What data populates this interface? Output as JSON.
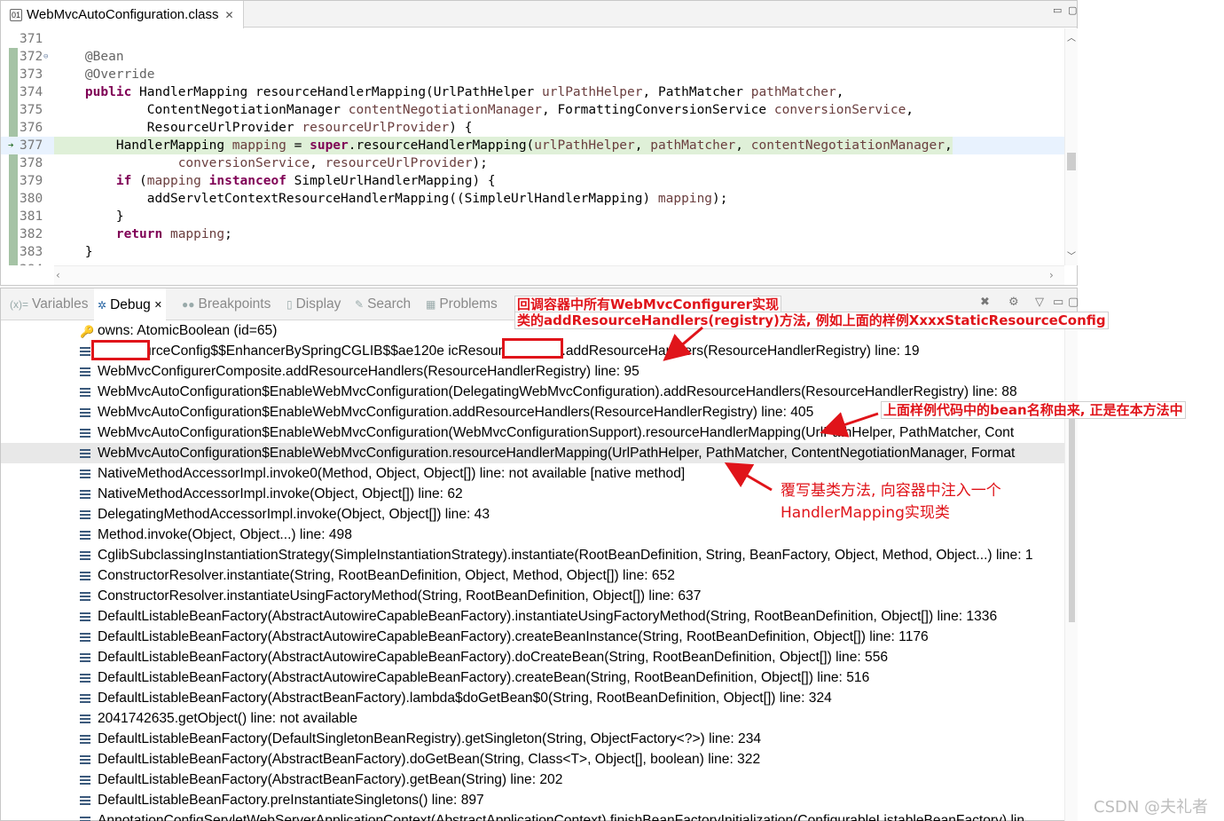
{
  "editor": {
    "tab_title": "WebMvcAutoConfiguration.class",
    "tab_icon": "class-file-icon",
    "lines": [
      {
        "num": "371",
        "tokens": [
          {
            "t": "",
            "c": ""
          }
        ]
      },
      {
        "num": "372",
        "tokens": [
          {
            "t": "    @Bean",
            "c": "ann"
          }
        ]
      },
      {
        "num": "373",
        "tokens": [
          {
            "t": "    @Override",
            "c": "ann"
          }
        ]
      },
      {
        "num": "374",
        "tokens": [
          {
            "t": "    ",
            "c": ""
          },
          {
            "t": "public",
            "c": "kw"
          },
          {
            "t": " HandlerMapping resourceHandlerMapping(UrlPathHelper ",
            "c": ""
          },
          {
            "t": "urlPathHelper",
            "c": "pr"
          },
          {
            "t": ", PathMatcher ",
            "c": ""
          },
          {
            "t": "pathMatcher",
            "c": "pr"
          },
          {
            "t": ",",
            "c": ""
          }
        ]
      },
      {
        "num": "375",
        "tokens": [
          {
            "t": "            ContentNegotiationManager ",
            "c": ""
          },
          {
            "t": "contentNegotiationManager",
            "c": "pr"
          },
          {
            "t": ", FormattingConversionService ",
            "c": ""
          },
          {
            "t": "conversionService",
            "c": "pr"
          },
          {
            "t": ",",
            "c": ""
          }
        ]
      },
      {
        "num": "376",
        "tokens": [
          {
            "t": "            ResourceUrlProvider ",
            "c": ""
          },
          {
            "t": "resourceUrlProvider",
            "c": "pr"
          },
          {
            "t": ") {",
            "c": ""
          }
        ]
      },
      {
        "num": "377",
        "tokens": [
          {
            "t": "        HandlerMapping ",
            "c": ""
          },
          {
            "t": "mapping",
            "c": "pr"
          },
          {
            "t": " = ",
            "c": ""
          },
          {
            "t": "super",
            "c": "kw"
          },
          {
            "t": ".resourceHandlerMapping(",
            "c": ""
          },
          {
            "t": "urlPathHelper",
            "c": "pr"
          },
          {
            "t": ", ",
            "c": ""
          },
          {
            "t": "pathMatcher",
            "c": "pr"
          },
          {
            "t": ", ",
            "c": ""
          },
          {
            "t": "contentNegotiationManager",
            "c": "pr"
          },
          {
            "t": ",",
            "c": ""
          }
        ]
      },
      {
        "num": "378",
        "tokens": [
          {
            "t": "                ",
            "c": ""
          },
          {
            "t": "conversionService",
            "c": "pr"
          },
          {
            "t": ", ",
            "c": ""
          },
          {
            "t": "resourceUrlProvider",
            "c": "pr"
          },
          {
            "t": ");",
            "c": ""
          }
        ]
      },
      {
        "num": "379",
        "tokens": [
          {
            "t": "        ",
            "c": ""
          },
          {
            "t": "if",
            "c": "kw"
          },
          {
            "t": " (",
            "c": ""
          },
          {
            "t": "mapping",
            "c": "pr"
          },
          {
            "t": " ",
            "c": ""
          },
          {
            "t": "instanceof",
            "c": "kw"
          },
          {
            "t": " SimpleUrlHandlerMapping) {",
            "c": ""
          }
        ]
      },
      {
        "num": "380",
        "tokens": [
          {
            "t": "            addServletContextResourceHandlerMapping((SimpleUrlHandlerMapping) ",
            "c": ""
          },
          {
            "t": "mapping",
            "c": "pr"
          },
          {
            "t": ");",
            "c": ""
          }
        ]
      },
      {
        "num": "381",
        "tokens": [
          {
            "t": "        }",
            "c": ""
          }
        ]
      },
      {
        "num": "382",
        "tokens": [
          {
            "t": "        ",
            "c": ""
          },
          {
            "t": "return",
            "c": "kw"
          },
          {
            "t": " ",
            "c": ""
          },
          {
            "t": "mapping",
            "c": "pr"
          },
          {
            "t": ";",
            "c": ""
          }
        ]
      },
      {
        "num": "383",
        "tokens": [
          {
            "t": "    }",
            "c": ""
          }
        ]
      },
      {
        "num": "384",
        "tokens": [
          {
            "t": "",
            "c": ""
          }
        ]
      }
    ],
    "highlighted_line": "377"
  },
  "debug": {
    "tabs": [
      {
        "label": "Variables",
        "icon": "variables-icon",
        "active": false
      },
      {
        "label": "Debug",
        "icon": "debug-bug-icon",
        "active": true
      },
      {
        "label": "Breakpoints",
        "icon": "breakpoints-icon",
        "active": false
      },
      {
        "label": "Display",
        "icon": "display-icon",
        "active": false
      },
      {
        "label": "Search",
        "icon": "search-icon",
        "active": false
      },
      {
        "label": "Problems",
        "icon": "problems-icon",
        "active": false
      }
    ],
    "owns": "owns: AtomicBoolean  (id=65)",
    "frames": [
      "        ticResourceConfig$$EnhancerBySpringCGLIB$$ae120e                    icResourceConfig).addResourceHandlers(ResourceHandlerRegistry) line: 19",
      "WebMvcConfigurerComposite.addResourceHandlers(ResourceHandlerRegistry) line: 95",
      "WebMvcAutoConfiguration$EnableWebMvcConfiguration(DelegatingWebMvcConfiguration).addResourceHandlers(ResourceHandlerRegistry) line: 88",
      "WebMvcAutoConfiguration$EnableWebMvcConfiguration.addResourceHandlers(ResourceHandlerRegistry) line: 405",
      "WebMvcAutoConfiguration$EnableWebMvcConfiguration(WebMvcConfigurationSupport).resourceHandlerMapping(UrlPathHelper, PathMatcher, Cont",
      "WebMvcAutoConfiguration$EnableWebMvcConfiguration.resourceHandlerMapping(UrlPathHelper, PathMatcher, ContentNegotiationManager, Format",
      "NativeMethodAccessorImpl.invoke0(Method, Object, Object[]) line: not available [native method]",
      "NativeMethodAccessorImpl.invoke(Object, Object[]) line: 62",
      "DelegatingMethodAccessorImpl.invoke(Object, Object[]) line: 43",
      "Method.invoke(Object, Object...) line: 498",
      "CglibSubclassingInstantiationStrategy(SimpleInstantiationStrategy).instantiate(RootBeanDefinition, String, BeanFactory, Object, Method, Object...) line: 1",
      "ConstructorResolver.instantiate(String, RootBeanDefinition, Object, Method, Object[]) line: 652",
      "ConstructorResolver.instantiateUsingFactoryMethod(String, RootBeanDefinition, Object[]) line: 637",
      "DefaultListableBeanFactory(AbstractAutowireCapableBeanFactory).instantiateUsingFactoryMethod(String, RootBeanDefinition, Object[]) line: 1336",
      "DefaultListableBeanFactory(AbstractAutowireCapableBeanFactory).createBeanInstance(String, RootBeanDefinition, Object[]) line: 1176",
      "DefaultListableBeanFactory(AbstractAutowireCapableBeanFactory).doCreateBean(String, RootBeanDefinition, Object[]) line: 556",
      "DefaultListableBeanFactory(AbstractAutowireCapableBeanFactory).createBean(String, RootBeanDefinition, Object[]) line: 516",
      "DefaultListableBeanFactory(AbstractBeanFactory).lambda$doGetBean$0(String, RootBeanDefinition, Object[]) line: 324",
      "2041742635.getObject() line: not available",
      "DefaultListableBeanFactory(DefaultSingletonBeanRegistry).getSingleton(String, ObjectFactory<?>) line: 234",
      "DefaultListableBeanFactory(AbstractBeanFactory).doGetBean(String, Class<T>, Object[], boolean) line: 322",
      "DefaultListableBeanFactory(AbstractBeanFactory).getBean(String) line: 202",
      "DefaultListableBeanFactory.preInstantiateSingletons() line: 897",
      "AnnotationConfigServletWebServerApplicationContext(AbstractApplicationContext).finishBeanFactoryInitialization(ConfigurableListableBeanFactory) lin"
    ],
    "selected_frame_index": 5
  },
  "annotations": {
    "callout1_line1": "回调容器中所有WebMvcConfigurer实现",
    "callout1_line2": "类的addResourceHandlers(registry)方法, 例如上面的样例XxxxStaticResourceConfig",
    "callout2": "上面样例代码中的bean名称由来, 正是在本方法中",
    "callout3_line1": "覆写基类方法, 向容器中注入一个",
    "callout3_line2": "HandlerMapping实现类",
    "annotation_color": "#e0141a"
  },
  "watermark": "CSDN @夫礼者"
}
